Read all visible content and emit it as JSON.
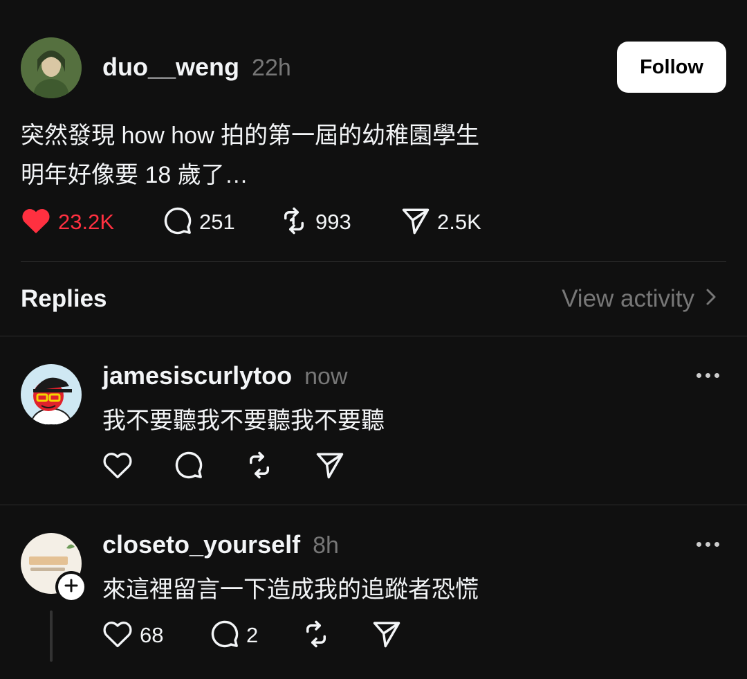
{
  "post": {
    "author": "duo__weng",
    "time": "22h",
    "follow_label": "Follow",
    "text_lines": [
      "突然發現 how how 拍的第一屆的幼稚園學生",
      "明年好像要 18 歲了…"
    ],
    "stats": {
      "likes": "23.2K",
      "replies": "251",
      "reposts": "993",
      "shares": "2.5K"
    },
    "like_color": "#ff3040"
  },
  "replies_header": {
    "title": "Replies",
    "view_activity": "View activity"
  },
  "replies": [
    {
      "author": "jamesiscurlytoo",
      "time": "now",
      "text": "我不要聽我不要聽我不要聽"
    },
    {
      "author": "closeto_yourself",
      "time": "8h",
      "text": "來這裡留言一下造成我的追蹤者恐慌",
      "likes": "68",
      "replies": "2"
    }
  ]
}
